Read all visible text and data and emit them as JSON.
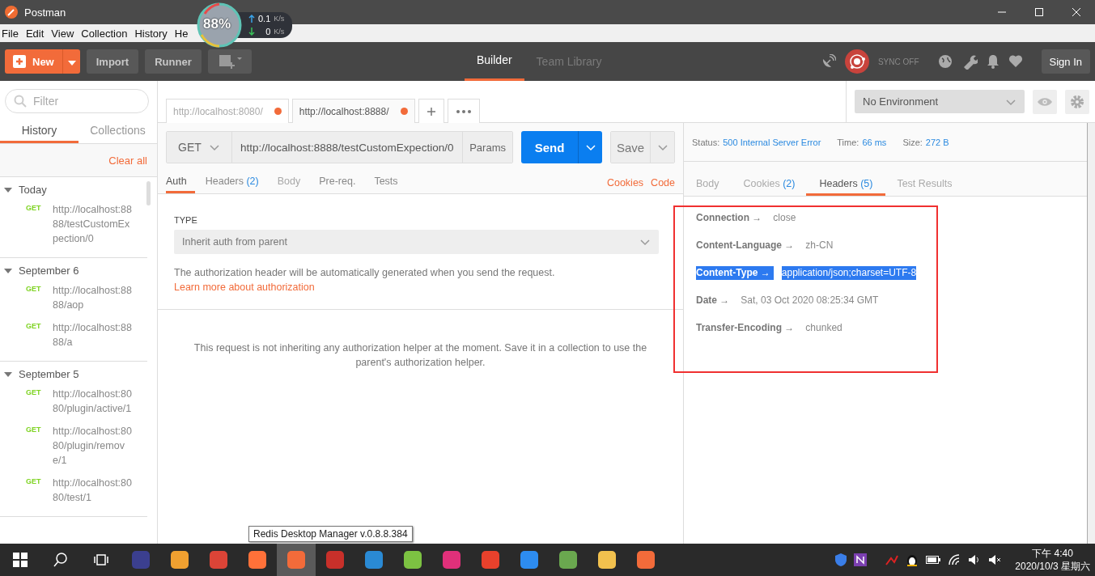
{
  "window": {
    "title": "Postman"
  },
  "menu": [
    "File",
    "Edit",
    "View",
    "Collection",
    "History",
    "He"
  ],
  "speed_widget": {
    "percent": "88%",
    "up": "0.1",
    "up_unit": "K/s",
    "down": "0",
    "down_unit": "K/s"
  },
  "toolbar": {
    "new_button": "New",
    "import_button": "Import",
    "runner_button": "Runner",
    "nav_tabs": [
      {
        "label": "Builder",
        "selected": true
      },
      {
        "label": "Team Library",
        "selected": false
      }
    ],
    "sync": "SYNC OFF",
    "sign_in": "Sign In"
  },
  "sidebar": {
    "filter_placeholder": "Filter",
    "tabs": [
      {
        "label": "History",
        "selected": true
      },
      {
        "label": "Collections",
        "selected": false
      }
    ],
    "clear_all": "Clear all",
    "groups": [
      {
        "label": "Today",
        "expanded": true,
        "items": [
          {
            "method": "GET",
            "url": "http://localhost:8888/testCustomExpection/0"
          }
        ]
      },
      {
        "label": "September 6",
        "expanded": true,
        "items": [
          {
            "method": "GET",
            "url": "http://localhost:8888/aop"
          },
          {
            "method": "GET",
            "url": "http://localhost:8888/a"
          }
        ]
      },
      {
        "label": "September 5",
        "expanded": true,
        "items": [
          {
            "method": "GET",
            "url": "http://localhost:8080/plugin/active/1"
          },
          {
            "method": "GET",
            "url": "http://localhost:8080/plugin/remove/1"
          },
          {
            "method": "GET",
            "url": "http://localhost:8080/test/1"
          }
        ]
      }
    ]
  },
  "request_tabs": [
    {
      "label": "http://localhost:8080/",
      "selected": false,
      "unsaved": true
    },
    {
      "label": "http://localhost:8888/",
      "selected": true,
      "unsaved": true
    }
  ],
  "environment": {
    "value": "No Environment"
  },
  "request": {
    "method": "GET",
    "url": "http://localhost:8888/testCustomExpection/0",
    "params": "Params",
    "send": "Send",
    "save": "Save"
  },
  "request_sections": [
    {
      "label": "Auth",
      "selected": true,
      "disabled": false
    },
    {
      "label": "Headers",
      "count": "(2)",
      "selected": false,
      "disabled": false
    },
    {
      "label": "Body",
      "selected": false,
      "disabled": true
    },
    {
      "label": "Pre-req.",
      "selected": false,
      "disabled": false
    },
    {
      "label": "Tests",
      "selected": false,
      "disabled": false
    }
  ],
  "request_links": [
    "Cookies",
    "Code"
  ],
  "auth": {
    "type_label": "TYPE",
    "type_value": "Inherit auth from parent",
    "description": "The authorization header will be automatically generated when you send the request.",
    "learn_more": "Learn more about authorization",
    "notice": "This request is not inheriting any authorization helper at the moment. Save it in a collection to use the parent's authorization helper."
  },
  "response": {
    "status_label": "Status:",
    "status": "500 Internal Server Error",
    "time_label": "Time:",
    "time": "66 ms",
    "size_label": "Size:",
    "size": "272 B",
    "tabs": [
      {
        "label": "Body",
        "selected": false
      },
      {
        "label": "Cookies",
        "count": "(2)",
        "selected": false
      },
      {
        "label": "Headers",
        "count": "(5)",
        "selected": true
      },
      {
        "label": "Test Results",
        "selected": false
      }
    ],
    "headers": [
      {
        "name": "Connection →",
        "value": "close",
        "selected": false
      },
      {
        "name": "Content-Language →",
        "value": "zh-CN",
        "selected": false
      },
      {
        "name": "Content-Type →",
        "value": "application/json;charset=UTF-8",
        "selected": true
      },
      {
        "name": "Date →",
        "value": "Sat, 03 Oct 2020 08:25:34 GMT",
        "selected": false
      },
      {
        "name": "Transfer-Encoding →",
        "value": "chunked",
        "selected": false
      }
    ]
  },
  "tooltip": "Redis Desktop Manager v.0.8.8.384",
  "taskbar": {
    "apps": [
      {
        "color": "#3b3f8f",
        "selected": false
      },
      {
        "color": "#f0a030",
        "selected": false
      },
      {
        "color": "#db4437",
        "selected": false
      },
      {
        "color": "#ff7139",
        "selected": false
      },
      {
        "color": "#f26b3a",
        "selected": true
      },
      {
        "color": "#c8302a",
        "selected": false
      },
      {
        "color": "#2a8ad4",
        "selected": false
      },
      {
        "color": "#7cc242",
        "selected": false
      },
      {
        "color": "#e0307a",
        "selected": false
      },
      {
        "color": "#e8412c",
        "selected": false
      },
      {
        "color": "#2d8cf0",
        "selected": false
      },
      {
        "color": "#6aa84f",
        "selected": false
      },
      {
        "color": "#f2c14e",
        "selected": false
      },
      {
        "color": "#f26b3a",
        "selected": false
      }
    ],
    "time": "下午 4:40",
    "date": "2020/10/3 星期六"
  }
}
